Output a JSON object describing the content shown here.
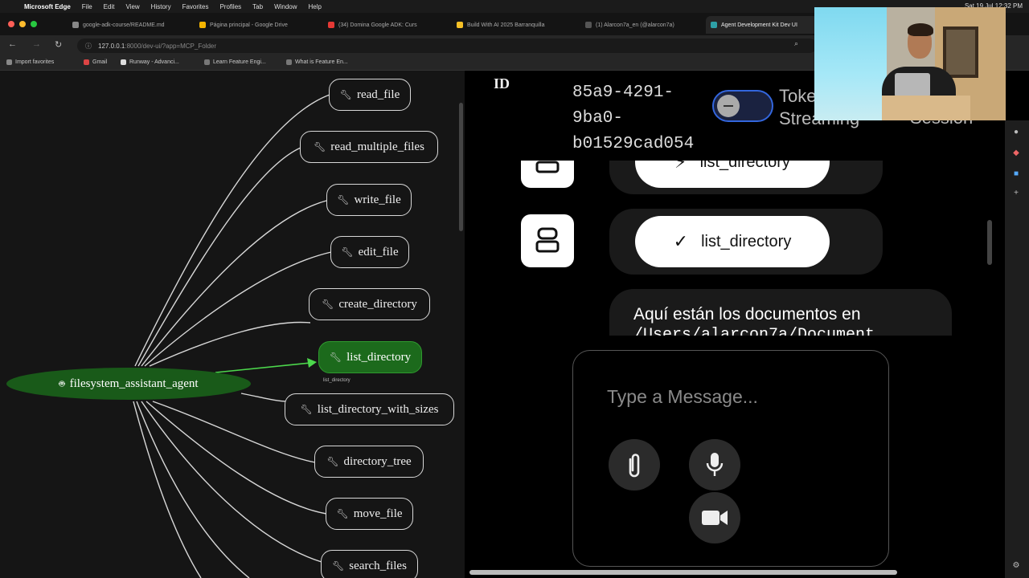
{
  "menubar": {
    "app": "Microsoft Edge",
    "items": [
      "File",
      "Edit",
      "View",
      "History",
      "Favorites",
      "Profiles",
      "Tab",
      "Window",
      "Help"
    ],
    "clock": "Sat 19 Jul 12:32 PM"
  },
  "tabs": [
    {
      "label": "google-adk-course/README.md",
      "color": "#888888"
    },
    {
      "label": "Página principal - Google Drive",
      "color": "#f4b400"
    },
    {
      "label": "(34) Domina Google ADK: Curs",
      "color": "#e53935"
    },
    {
      "label": "Build With AI 2025 Barranquilla",
      "color": "#f6c026"
    },
    {
      "label": "(1) Alarcon7a_en (@alarcon7a)",
      "color": "#555555"
    },
    {
      "label": "Agent Development Kit Dev UI",
      "color": "#2ea0a6"
    }
  ],
  "address": {
    "host": "127.0.0.1",
    "rest": ":8000/dev-ui/?app=MCP_Folder"
  },
  "bookmarks": [
    "Import favorites",
    "Gmail",
    "Runway - Advanci...",
    "Learn Feature Engi...",
    "What is Feature En..."
  ],
  "graph": {
    "agent": "filesystem_assistant_agent",
    "tools": [
      "read_file",
      "read_multiple_files",
      "write_file",
      "edit_file",
      "create_directory",
      "list_directory",
      "list_directory_with_sizes",
      "directory_tree",
      "move_file",
      "search_files"
    ],
    "active_tool": "list_directory",
    "edge_label": "list_directory"
  },
  "header": {
    "id_label": "ID",
    "session_id": "85a9-4291-9ba0-b01529cad054",
    "session_id_lines": [
      "85a9-4291-",
      "9ba0-",
      "b01529cad054"
    ],
    "token_label_lines": [
      "Toke",
      "Streaming"
    ],
    "session_label": "Session"
  },
  "messages": {
    "function_call": "list_directory",
    "function_response": "list_directory",
    "text_line1": "Aquí están los documentos en",
    "text_line2": "/Users/alarcon7a/Document"
  },
  "composer": {
    "placeholder": "Type a Message...",
    "attach_icon": "paperclip-icon",
    "mic_icon": "microphone-icon",
    "video_icon": "video-camera-icon"
  },
  "colors": {
    "active_node": "#1c6a1c",
    "agent_node": "#195a19",
    "edge": "#d8d8d8",
    "active_edge": "#4cd84c",
    "toggle_border": "#3366dd"
  }
}
